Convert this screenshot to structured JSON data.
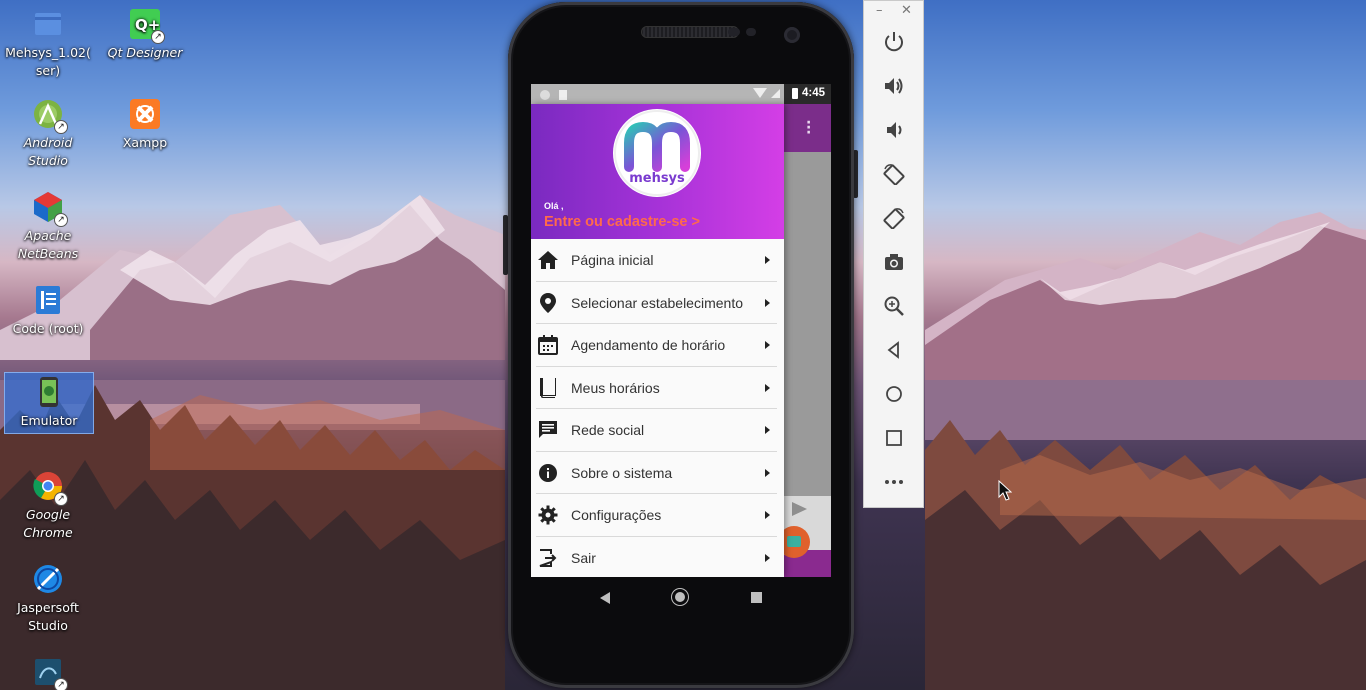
{
  "desktop": {
    "icons": [
      {
        "label": "Mehsys_1.02( ser)",
        "icon": "folder-icon"
      },
      {
        "label": "Qt Designer",
        "icon": "qt-designer-icon"
      },
      {
        "label": "Android Studio",
        "icon": "android-studio-icon"
      },
      {
        "label": "Xampp",
        "icon": "xampp-icon"
      },
      {
        "label": "Apache NetBeans",
        "icon": "netbeans-icon"
      },
      {
        "label": "Code (root)",
        "icon": "vscode-icon"
      },
      {
        "label": "Emulator",
        "icon": "emulator-icon",
        "selected": true
      },
      {
        "label": "Google Chrome",
        "icon": "chrome-icon"
      },
      {
        "label": "Jaspersoft Studio",
        "icon": "jaspersoft-icon"
      },
      {
        "label": "",
        "icon": "mysql-workbench-icon"
      }
    ]
  },
  "phone": {
    "status_bar": {
      "time": "4:45",
      "icons": [
        "notification-dot-icon",
        "sim-card-icon",
        "wifi-icon",
        "signal-icon",
        "battery-icon"
      ]
    },
    "drawer": {
      "logo_text": "mehsys",
      "greeting": "Olá ,",
      "login_link": "Entre ou cadastre-se >",
      "menu": [
        {
          "label": "Página inicial",
          "icon": "home-icon"
        },
        {
          "label": "Selecionar estabelecimento",
          "icon": "location-pin-icon"
        },
        {
          "label": "Agendamento de horário",
          "icon": "calendar-icon"
        },
        {
          "label": "Meus horários",
          "icon": "book-icon"
        },
        {
          "label": "Rede social",
          "icon": "chat-icon"
        },
        {
          "label": "Sobre o sistema",
          "icon": "info-icon"
        },
        {
          "label": "Configurações",
          "icon": "gear-icon"
        },
        {
          "label": "Sair",
          "icon": "logout-icon"
        }
      ]
    },
    "colors": {
      "header_start": "#7a2ac0",
      "header_end": "#d43ee6",
      "login_link": "#ff6a4b"
    }
  },
  "emulator_toolbar": {
    "window_controls": [
      "minimize-icon",
      "close-icon"
    ],
    "buttons": [
      "power-icon",
      "volume-up-icon",
      "volume-down-icon",
      "rotate-left-icon",
      "rotate-right-icon",
      "camera-icon",
      "zoom-icon",
      "back-icon",
      "home-icon",
      "overview-icon",
      "more-icon"
    ]
  }
}
